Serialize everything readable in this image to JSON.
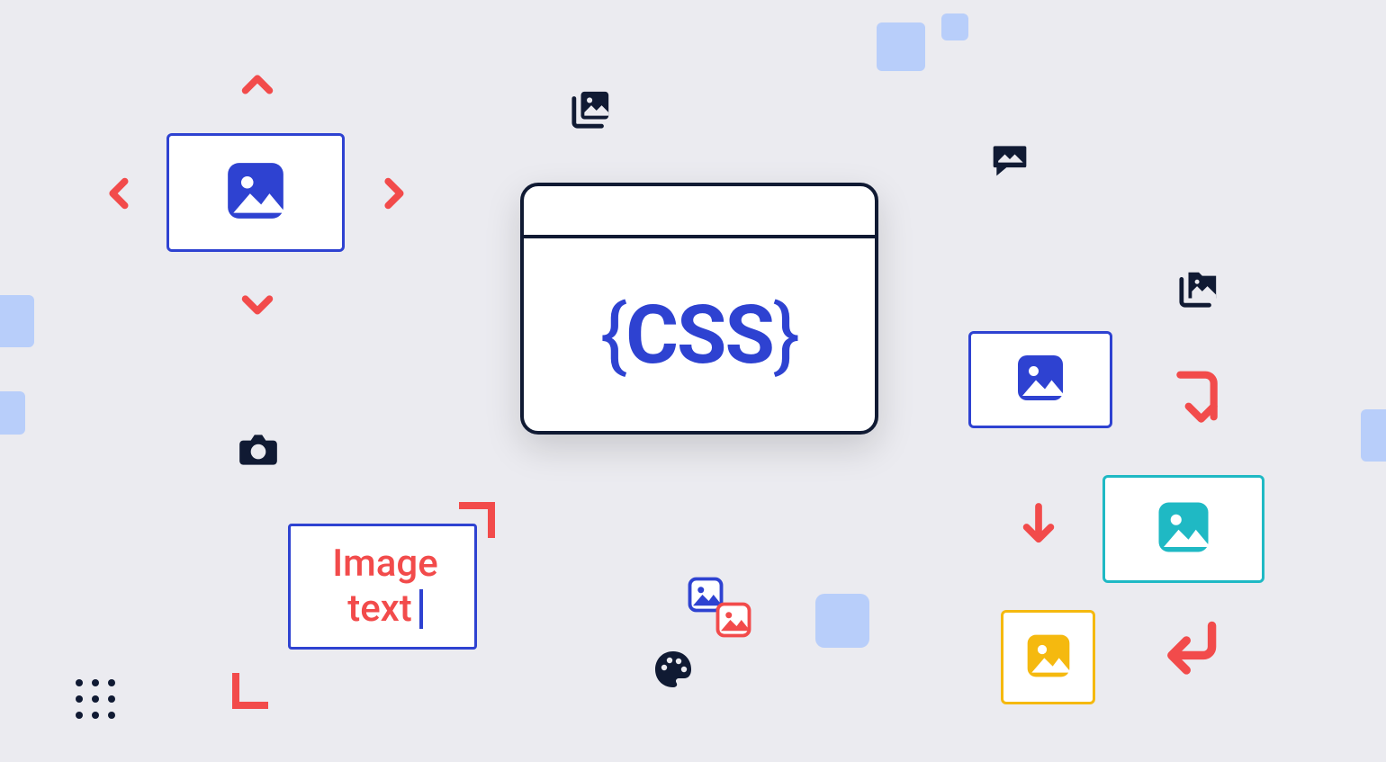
{
  "main_window": {
    "title_text": "CSS",
    "brace_open": "{",
    "brace_close": "}"
  },
  "image_text_card": {
    "line1": "Image",
    "line2": "text"
  },
  "colors": {
    "background": "#EBEBF0",
    "primary_blue": "#2E42D1",
    "accent_red": "#F24B4B",
    "dark_navy": "#101A33",
    "light_blue": "#B8CEFA",
    "teal": "#1FB9C4",
    "yellow": "#F5B90F"
  },
  "icons": {
    "image": "image-icon",
    "image_stack": "image-stack-icon",
    "image_folder": "image-folder-icon",
    "camera": "camera-icon",
    "palette": "palette-icon",
    "chat_image": "chat-image-icon",
    "chevron_up": "chevron-up-icon",
    "chevron_down": "chevron-down-icon",
    "chevron_left": "chevron-left-icon",
    "chevron_right": "chevron-right-icon",
    "arrow_down": "arrow-down-icon",
    "arrow_down_left": "arrow-down-left-icon",
    "arrow_return": "arrow-return-icon"
  }
}
